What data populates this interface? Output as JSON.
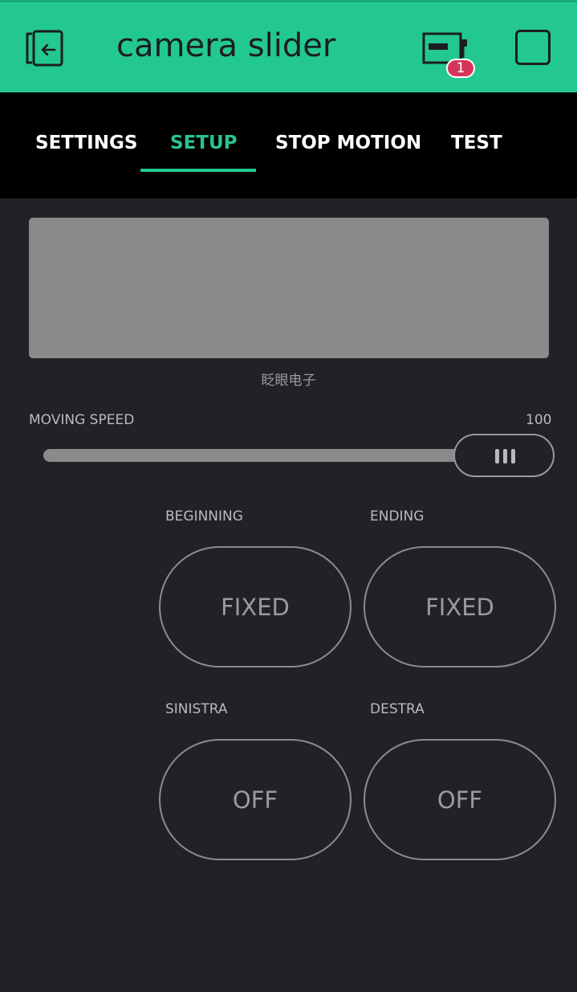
{
  "header": {
    "title": "camera slider",
    "badge_count": "1",
    "back_icon": "exit-icon",
    "device_icon": "device-board-icon",
    "stop_icon": "stop-square-icon",
    "accent": "#23c890"
  },
  "tabs": [
    {
      "label": "SETTINGS",
      "active": false
    },
    {
      "label": "SETUP",
      "active": true
    },
    {
      "label": "STOP MOTION",
      "active": false
    },
    {
      "label": "TEST",
      "active": false
    }
  ],
  "video": {
    "caption": "眨眼电子"
  },
  "speed": {
    "label": "MOVING SPEED",
    "value": "100"
  },
  "buttons": {
    "beginning": {
      "label": "BEGINNING",
      "text": "FIXED"
    },
    "ending": {
      "label": "ENDING",
      "text": "FIXED"
    },
    "sinistra": {
      "label": "SINISTRA",
      "text": "OFF"
    },
    "destra": {
      "label": "DESTRA",
      "text": "OFF"
    }
  }
}
